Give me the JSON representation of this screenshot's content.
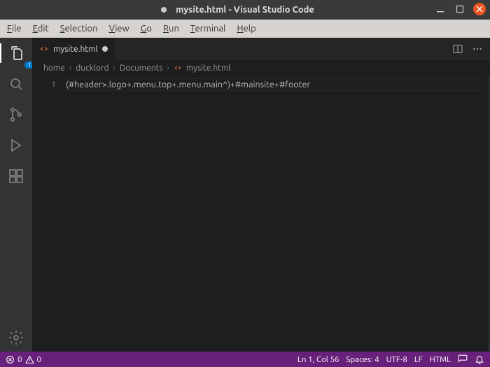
{
  "window": {
    "title": "mysite.html - Visual Studio Code",
    "modified": "●"
  },
  "menubar": [
    "File",
    "Edit",
    "Selection",
    "View",
    "Go",
    "Run",
    "Terminal",
    "Help"
  ],
  "activitybar": {
    "explorer_badge": "1"
  },
  "tab": {
    "filename": "mysite.html",
    "dirty_indicator": "●"
  },
  "breadcrumb": {
    "parts": [
      "home",
      "ducklord",
      "Documents",
      "mysite.html"
    ]
  },
  "editor": {
    "line_number": "1",
    "line1": "(#header>.logo+.menu.top+.menu.main^)+#mainsite+#footer"
  },
  "statusbar": {
    "errors": "0",
    "warnings": "0",
    "cursor": "Ln 1, Col 56",
    "spaces": "Spaces: 4",
    "encoding": "UTF-8",
    "eol": "LF",
    "language": "HTML"
  }
}
